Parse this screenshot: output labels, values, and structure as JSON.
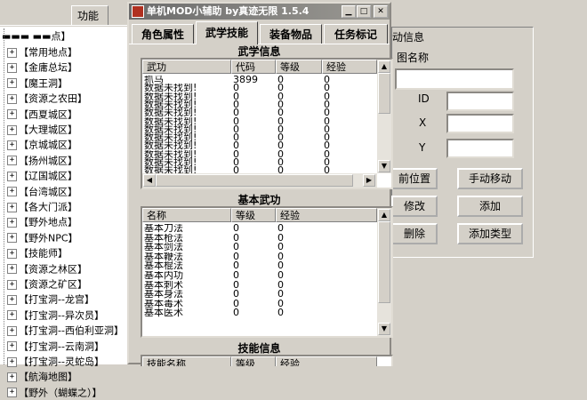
{
  "left": {
    "tab_label": "功能",
    "top_item": "▬▬▬ ▬▬点】",
    "tree": [
      "【常用地点】",
      "【金庸总坛】",
      "【魔王洞】",
      "【资源之农田】",
      "【西夏城区】",
      "【大理城区】",
      "【京城城区】",
      "【扬州城区】",
      "【辽国城区】",
      "【台湾城区】",
      "【各大门派】",
      "【野外地点】",
      "【野外NPC】",
      "【技能师】",
      "【资源之林区】",
      "【资源之矿区】",
      "【打宝洞--龙宫】",
      "【打宝洞--异次员】",
      "【打宝洞--西伯利亚洞】",
      "【打宝洞--云南洞】",
      "【打宝洞--灵蛇岛】",
      "【航海地图】",
      "【野外（蝴蝶之）】"
    ]
  },
  "dialog": {
    "title": "单机MOD小辅助  by真迹无限  1.5.4",
    "tabs": [
      "角色属性",
      "武学技能",
      "装备物品",
      "任务标记"
    ],
    "active_tab": 1,
    "martial": {
      "title": "武学信息",
      "headers": [
        "武功",
        "代码",
        "等级",
        "经验"
      ],
      "rows": [
        [
          "抓马",
          "3899",
          "0",
          "0"
        ],
        [
          "数据未找到!",
          "0",
          "0",
          "0"
        ],
        [
          "数据未找到!",
          "0",
          "0",
          "0"
        ],
        [
          "数据未找到!",
          "0",
          "0",
          "0"
        ],
        [
          "数据未找到!",
          "0",
          "0",
          "0"
        ],
        [
          "数据未找到!",
          "0",
          "0",
          "0"
        ],
        [
          "数据未找到!",
          "0",
          "0",
          "0"
        ],
        [
          "数据未找到!",
          "0",
          "0",
          "0"
        ],
        [
          "数据未找到!",
          "0",
          "0",
          "0"
        ],
        [
          "数据未找到!",
          "0",
          "0",
          "0"
        ],
        [
          "数据未找到!",
          "0",
          "0",
          "0"
        ],
        [
          "数据未找到!",
          "0",
          "0",
          "0"
        ]
      ]
    },
    "basic": {
      "title": "基本武功",
      "headers": [
        "名称",
        "等级",
        "经验"
      ],
      "rows": [
        [
          "基本刀法",
          "0",
          "0"
        ],
        [
          "基本枪法",
          "0",
          "0"
        ],
        [
          "基本剑法",
          "0",
          "0"
        ],
        [
          "基本鞭法",
          "0",
          "0"
        ],
        [
          "基本棍法",
          "0",
          "0"
        ],
        [
          "基本内功",
          "0",
          "0"
        ],
        [
          "基本刺术",
          "0",
          "0"
        ],
        [
          "基本身法",
          "0",
          "0"
        ],
        [
          "基本毒术",
          "0",
          "0"
        ],
        [
          "基本医术",
          "0",
          "0"
        ]
      ]
    },
    "skills": {
      "title": "技能信息",
      "headers": [
        "技能名称",
        "等级",
        "经验"
      ]
    }
  },
  "right": {
    "group_label": "动信息",
    "name_label": "图名称",
    "id_label": "ID",
    "x_label": "X",
    "y_label": "Y",
    "buttons": {
      "current_pos": "前位置",
      "manual_move": "手动移动",
      "modify": "修改",
      "add": "添加",
      "delete": "删除",
      "add_type": "添加类型"
    }
  }
}
